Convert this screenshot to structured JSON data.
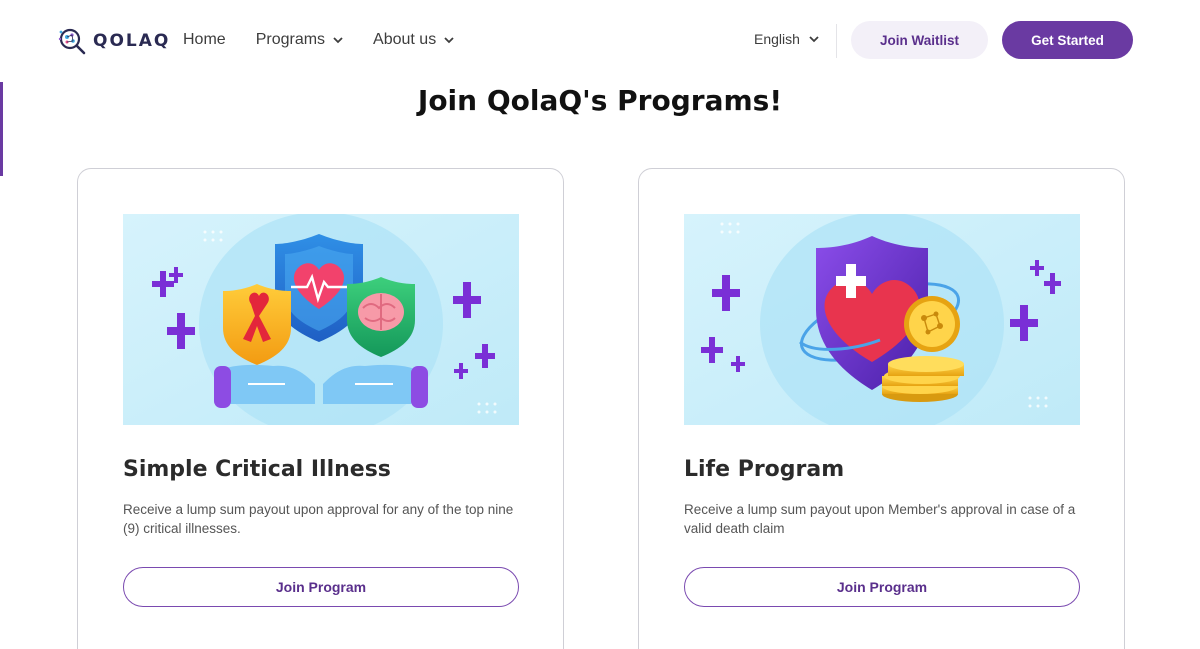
{
  "brand": {
    "name": "QOLAQ"
  },
  "nav": {
    "items": [
      {
        "label": "Home",
        "has_dropdown": false
      },
      {
        "label": "Programs",
        "has_dropdown": true
      },
      {
        "label": "About us",
        "has_dropdown": true
      }
    ]
  },
  "language": {
    "selected": "English"
  },
  "header_buttons": {
    "waitlist_label": "Join Waitlist",
    "get_started_label": "Get Started"
  },
  "page": {
    "title": "Join QolaQ's Programs!"
  },
  "programs": [
    {
      "title": "Simple Critical Illness",
      "description": "Receive a lump sum payout upon approval for any of the top nine (9) critical illnesses.",
      "button_label": "Join Program",
      "illustration": "shields-heart-ribbon-brain-icon"
    },
    {
      "title": "Life Program",
      "description": "Receive a lump sum payout upon Member's approval in case of a valid death claim",
      "button_label": "Join Program",
      "illustration": "shield-heart-coins-icon"
    }
  ],
  "colors": {
    "brand_purple": "#6a3aa2",
    "waitlist_bg": "#f3f0f8",
    "card_border": "#cfcfd6",
    "illustration_bg": "#c9eefa"
  }
}
